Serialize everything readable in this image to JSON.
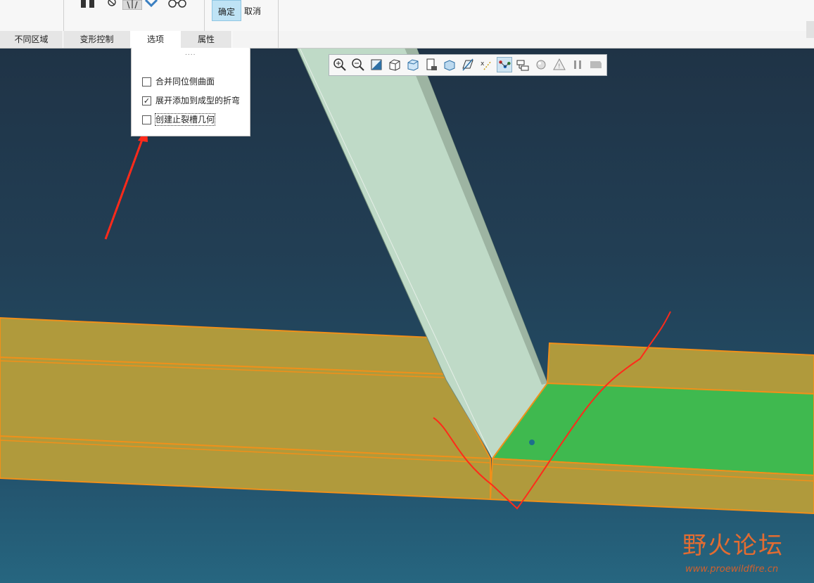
{
  "ribbon": {
    "ok_label": "确定",
    "cancel_label": "取消",
    "tabs": [
      {
        "label": "不同区域"
      },
      {
        "label": "变形控制"
      },
      {
        "label": "选项"
      },
      {
        "label": "属性"
      }
    ]
  },
  "options_panel": {
    "grip": "....",
    "options": [
      {
        "label": "合并同位侧曲面",
        "checked": false
      },
      {
        "label": "展开添加到成型的折弯",
        "checked": true
      },
      {
        "label": "创建止裂槽几何",
        "checked": false
      }
    ]
  },
  "view_toolbar": {
    "tools": [
      {
        "icon": "zoom-in-icon"
      },
      {
        "icon": "zoom-out-icon"
      },
      {
        "icon": "refit-icon"
      },
      {
        "icon": "display-style-icon"
      },
      {
        "icon": "saved-orientations-icon"
      },
      {
        "icon": "view-manager-icon"
      },
      {
        "icon": "perspective-view-icon"
      },
      {
        "icon": "datum-display-icon"
      },
      {
        "icon": "annotation-display-icon"
      },
      {
        "icon": "spin-center-icon"
      },
      {
        "icon": "model-tree-filter-icon"
      },
      {
        "icon": "appearance-icon"
      },
      {
        "icon": "feature-warning-icon"
      },
      {
        "icon": "pause-icon"
      },
      {
        "icon": "end-icon"
      }
    ]
  },
  "watermark": {
    "text": "野火论坛",
    "url": "www.proewildfire.cn"
  },
  "colors": {
    "viewport_top": "#1f3346",
    "viewport_bottom": "#266680",
    "flange_fill": "#b09a3c",
    "flange_edge": "#f0901a",
    "strip_fill": "#bfdac7",
    "selected_surface": "#3fb94f",
    "annotation_red": "#ff2a1a",
    "watermark_orange": "#e36c31"
  }
}
